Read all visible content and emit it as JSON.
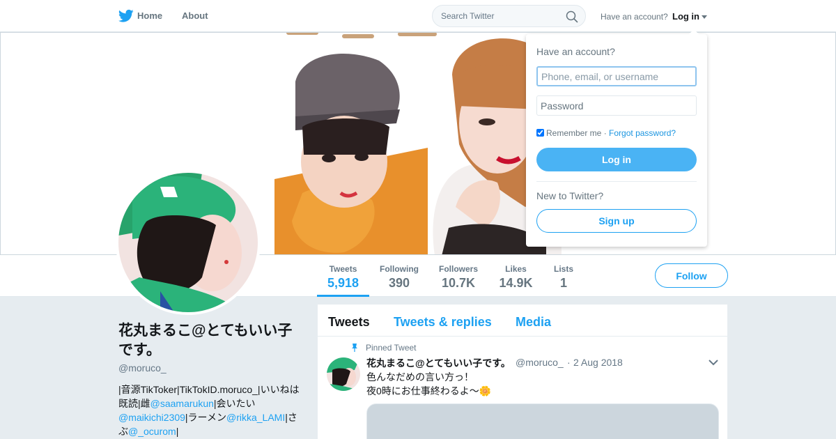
{
  "nav": {
    "home_label": "Home",
    "about_label": "About",
    "search_placeholder": "Search Twitter",
    "have_account_text": "Have an account?",
    "login_label": "Log in"
  },
  "profile": {
    "name": "花丸まるこ@とてもいい子です。",
    "handle": "@moruco_",
    "bio": {
      "t1": "|音源TikToker|TikTokID.moruco_|いいねは既読|雌",
      "link1": "@saamarukun",
      "t2": "|会いたい",
      "link2": "@maikichi2309",
      "t3": "|ラーメン",
      "link3": "@rikka_LAMI",
      "t4": "|さぶ",
      "link4": "@_ocurom",
      "t5": "|"
    },
    "follow_label": "Follow"
  },
  "stats": [
    {
      "label": "Tweets",
      "value": "5,918"
    },
    {
      "label": "Following",
      "value": "390"
    },
    {
      "label": "Followers",
      "value": "10.7K"
    },
    {
      "label": "Likes",
      "value": "14.9K"
    },
    {
      "label": "Lists",
      "value": "1"
    }
  ],
  "timeline": {
    "tabs": [
      "Tweets",
      "Tweets & replies",
      "Media"
    ],
    "pinned_label": "Pinned Tweet",
    "tweet": {
      "name": "花丸まるこ@とてもいい子です。",
      "handle": "@moruco_",
      "separator": "·",
      "date": "2 Aug 2018",
      "line1": "色んなだめの言い方っ！",
      "line2": "夜0時にお仕事終わるよ〜🌼"
    }
  },
  "login_dropdown": {
    "title": "Have an account?",
    "username_placeholder": "Phone, email, or username",
    "password_placeholder": "Password",
    "remember_label": "Remember me",
    "separator": "·",
    "forgot_label": "Forgot password?",
    "login_button": "Log in",
    "new_text": "New to Twitter?",
    "signup_button": "Sign up"
  },
  "colors": {
    "brand": "#1da1f2",
    "background": "#e6ecf0"
  }
}
